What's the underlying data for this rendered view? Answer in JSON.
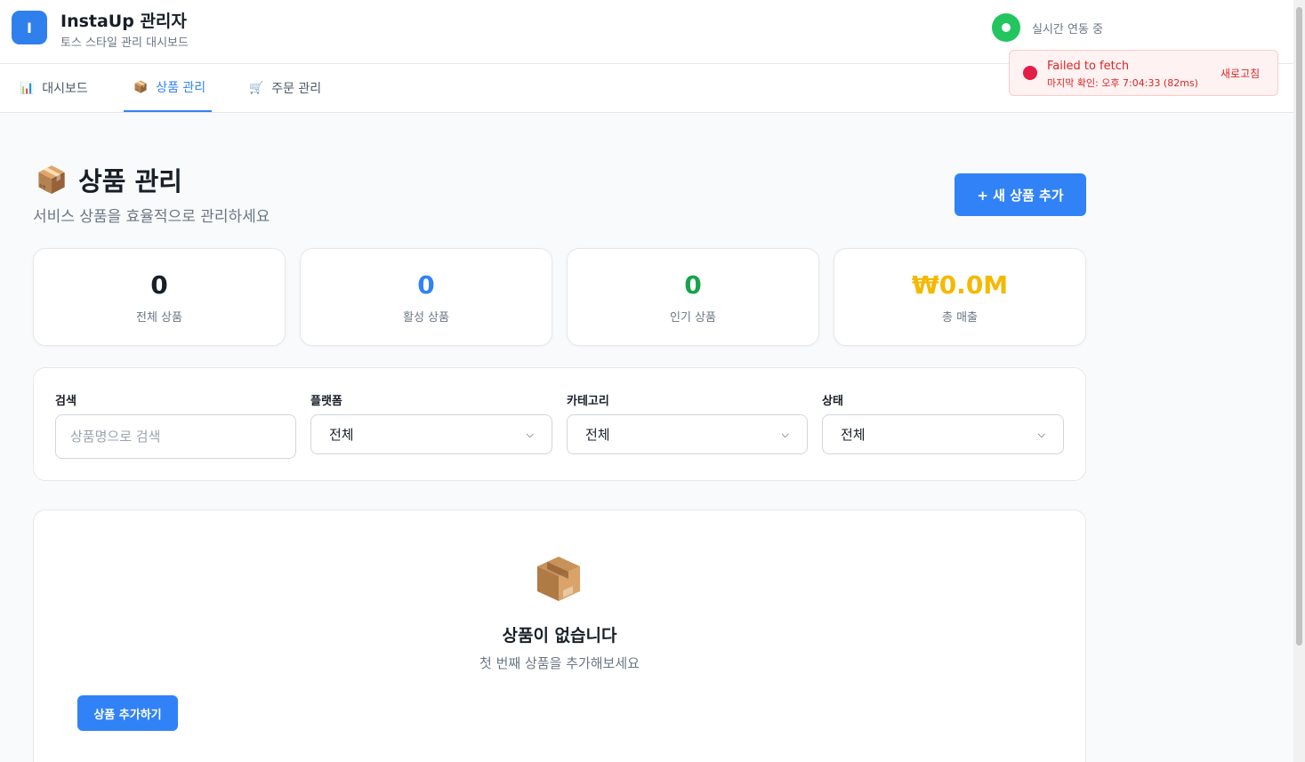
{
  "header": {
    "logo_letter": "I",
    "title": "InstaUp 관리자",
    "subtitle": "토스 스타일 관리 대시보드",
    "live_status": "실시간 연동 중"
  },
  "toast": {
    "title": "Failed to fetch",
    "time": "마지막 확인: 오후 7:04:33 (82ms)",
    "refresh_label": "새로고침"
  },
  "nav": {
    "tabs": [
      {
        "icon": "📊",
        "label": "대시보드"
      },
      {
        "icon": "📦",
        "label": "상품 관리"
      },
      {
        "icon": "🛒",
        "label": "주문 관리"
      }
    ]
  },
  "page": {
    "icon": "📦",
    "title": "상품 관리",
    "subtitle": "서비스 상품을 효율적으로 관리하세요",
    "add_button": "+ 새 상품 추가"
  },
  "stats": [
    {
      "value": "0",
      "label": "전체 상품",
      "color": "#191f28"
    },
    {
      "value": "0",
      "label": "활성 상품",
      "color": "#3182f6"
    },
    {
      "value": "0",
      "label": "인기 상품",
      "color": "#16a34a"
    },
    {
      "value": "₩0.0M",
      "label": "총 매출",
      "color": "#f5b800"
    }
  ],
  "filters": {
    "search": {
      "label": "검색",
      "placeholder": "상품명으로 검색",
      "value": ""
    },
    "platform": {
      "label": "플랫폼",
      "selected": "전체"
    },
    "category": {
      "label": "카테고리",
      "selected": "전체"
    },
    "status": {
      "label": "상태",
      "selected": "전체"
    }
  },
  "empty_state": {
    "icon": "📦",
    "title": "상품이 없습니다",
    "subtitle": "첫 번째 상품을 추가해보세요",
    "button": "상품 추가하기"
  },
  "colors": {
    "accent": "#3182f6",
    "live": "#22c55e",
    "error": "#dc2626"
  }
}
